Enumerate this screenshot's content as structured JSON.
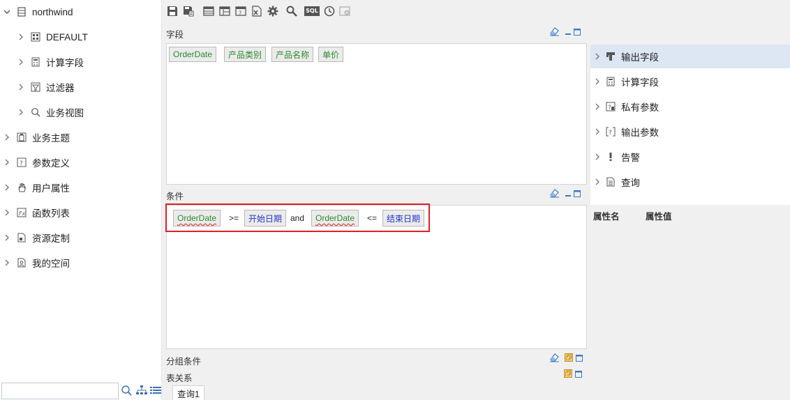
{
  "tree": {
    "root": "northwind",
    "children": [
      "DEFAULT",
      "计算字段",
      "过滤器",
      "业务视图"
    ],
    "top_items": [
      "业务主题",
      "参数定义",
      "用户属性",
      "函数列表",
      "资源定制",
      "我的空间"
    ]
  },
  "toolbar": {
    "icons": [
      "save-icon",
      "save-as-icon",
      "table-icon",
      "grid-icon",
      "param-icon",
      "excel-icon",
      "gear-icon",
      "search-icon",
      "sql-icon",
      "clock-icon",
      "settings-icon"
    ],
    "sql_label": "SQL"
  },
  "fields": {
    "title": "字段",
    "chips": [
      "OrderDate",
      "产品类别",
      "产品名称",
      "单价"
    ]
  },
  "conditions": {
    "title": "条件",
    "field1": "OrderDate",
    "op1": ">=",
    "param1": "开始日期",
    "conj": "and",
    "field2": "OrderDate",
    "op2": "<=",
    "param2": "结束日期"
  },
  "group_cond": {
    "title": "分组条件"
  },
  "relations": {
    "title": "表关系"
  },
  "tab": {
    "label": "查询1"
  },
  "right_tree": {
    "items": [
      "输出字段",
      "计算字段",
      "私有参数",
      "输出参数",
      "告警",
      "查询"
    ]
  },
  "props": {
    "name": "属性名",
    "value": "属性值"
  },
  "colors": {
    "highlight": "#e01f26",
    "field_text": "#2d8a2d",
    "param_text": "#2233cc",
    "selected_row": "#dde6f3"
  }
}
